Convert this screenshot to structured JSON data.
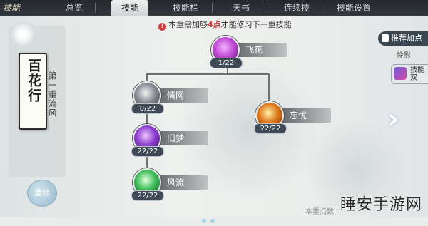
{
  "nav": {
    "corner_label": "技能",
    "tabs": [
      {
        "label": "总览"
      },
      {
        "label": "技能"
      },
      {
        "label": "技能栏"
      },
      {
        "label": "天书"
      },
      {
        "label": "连续技"
      },
      {
        "label": "技能设置"
      }
    ]
  },
  "sect": {
    "name": "百花行",
    "realm_label": "第一重流风",
    "repair_button": "重修"
  },
  "notice": {
    "prefix": "本重需加够",
    "highlight": "4点",
    "suffix": "才能修习下一重技能"
  },
  "skills": [
    {
      "name": "飞花",
      "level": "1/22",
      "icon": "feihua-skill-icon",
      "color": "#c24bd6"
    },
    {
      "name": "情网",
      "level": "0/22",
      "icon": "qingwang-skill-icon",
      "color": "#8a8f96"
    },
    {
      "name": "忘忧",
      "level": "22/22",
      "icon": "wangyou-skill-icon",
      "color": "#e07a1c"
    },
    {
      "name": "旧梦",
      "level": "22/22",
      "icon": "jiumeng-skill-icon",
      "color": "#8e3fd0"
    },
    {
      "name": "风流",
      "level": "22/22",
      "icon": "fengliu-skill-icon",
      "color": "#3fbf5a"
    }
  ],
  "right_panel": {
    "recommend_label": "推荐加点",
    "sub_label": "怜影",
    "skill_book_line1": "技能",
    "skill_book_line2": "双"
  },
  "bottom": {
    "note": "本重点数",
    "watermark": "睡安手游网"
  }
}
